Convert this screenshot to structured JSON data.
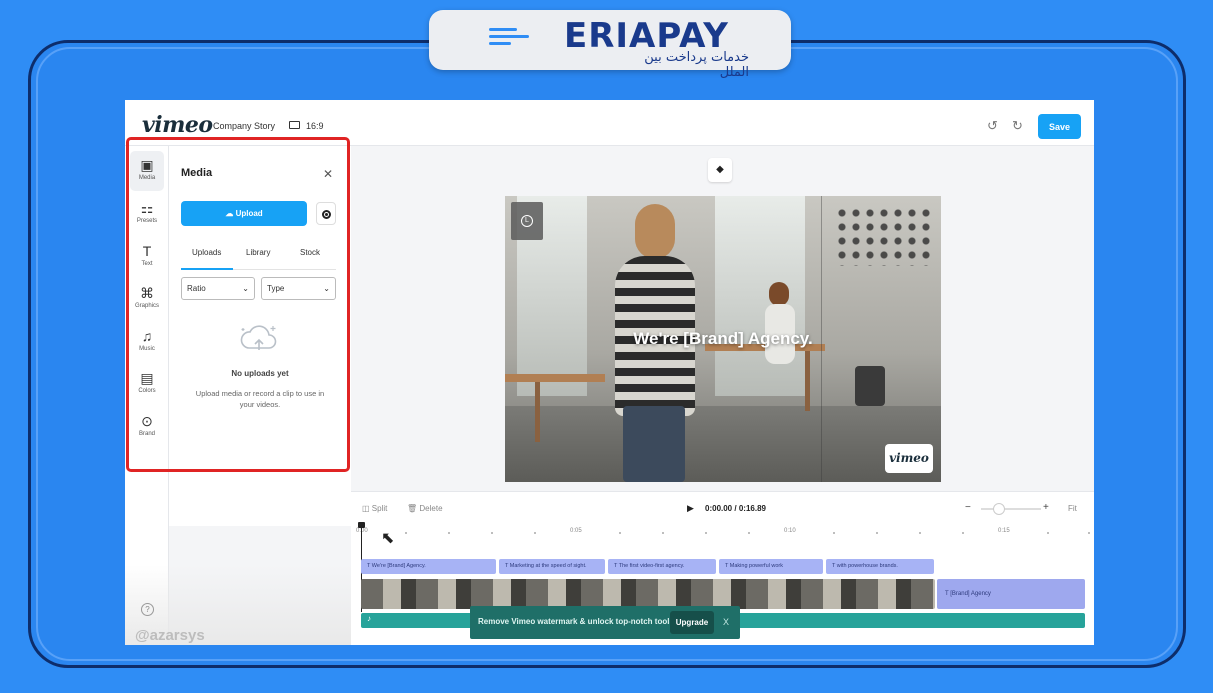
{
  "brand": {
    "name": "ERIAPAY",
    "tagline": "خدمات پرداخت بین الملل"
  },
  "header": {
    "logo": "vimeo",
    "project_title": "Company Story",
    "aspect_ratio": "16:9",
    "undo_icon": "undo-icon",
    "redo_icon": "redo-icon",
    "save_label": "Save"
  },
  "rail": {
    "items": [
      {
        "label": "Media",
        "icon": "image-icon",
        "active": true
      },
      {
        "label": "Presets",
        "icon": "grid-icon"
      },
      {
        "label": "Text",
        "icon": "text-icon"
      },
      {
        "label": "Graphics",
        "icon": "shapes-icon"
      },
      {
        "label": "Music",
        "icon": "music-icon"
      },
      {
        "label": "Colors",
        "icon": "palette-icon"
      },
      {
        "label": "Brand",
        "icon": "brand-icon"
      }
    ]
  },
  "media_panel": {
    "title": "Media",
    "upload_label": "Upload",
    "tabs": [
      {
        "label": "Uploads",
        "active": true
      },
      {
        "label": "Library"
      },
      {
        "label": "Stock"
      }
    ],
    "filters": {
      "ratio": "Ratio",
      "type": "Type"
    },
    "empty": {
      "title": "No uploads yet",
      "description": "Upload media or record a clip to use in your videos."
    }
  },
  "stage": {
    "overlay_text": "We're [Brand] Agency.",
    "watermark_logo": "vimeo"
  },
  "timeline": {
    "split_label": "Split",
    "delete_label": "Delete",
    "current_time": "0:00.00",
    "separator": "/",
    "duration": "0:16.89",
    "fit_label": "Fit",
    "ruler": [
      "0:00",
      "0:05",
      "0:10",
      "0:15"
    ],
    "captions": [
      "We're [Brand] Agency.",
      "Marketing at the speed of sight.",
      "The first video-first agency.",
      "Making powerful work",
      "with powerhouse brands."
    ],
    "end_clip": "[Brand] Agency"
  },
  "promo": {
    "text": "Remove Vimeo watermark & unlock top-notch tools.",
    "button": "Upgrade",
    "close": "X"
  },
  "footer": {
    "watermark": "@azarsys"
  },
  "colors": {
    "accent": "#17a2f5",
    "highlight": "#e02424",
    "caption_clip": "#a7b3f5",
    "audio_track": "#27a39a",
    "background": "#2f8df5"
  }
}
